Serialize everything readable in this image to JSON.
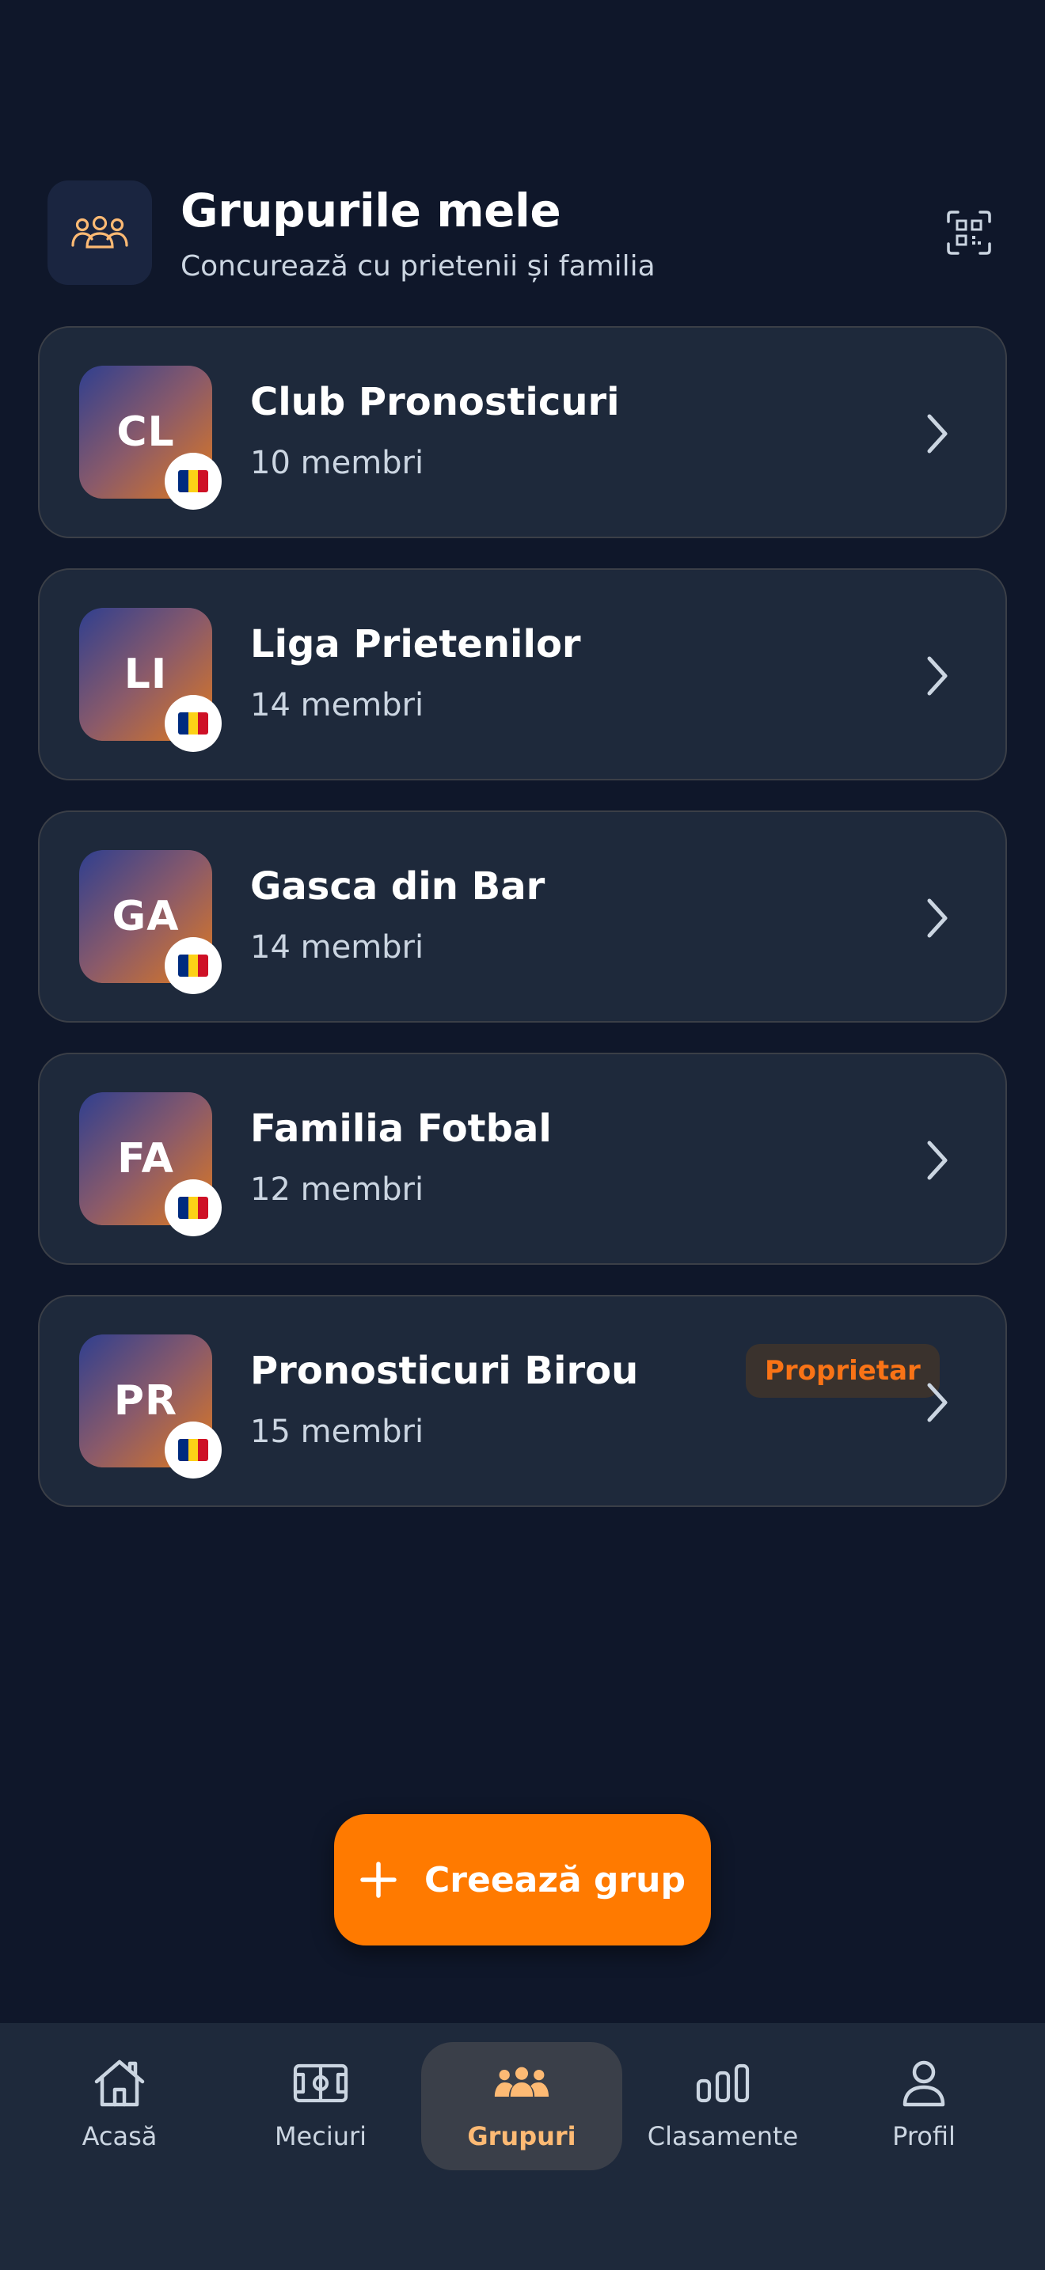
{
  "header": {
    "title": "Grupurile mele",
    "subtitle": "Concurează cu prietenii și familia",
    "icon": "groups-icon",
    "action_icon": "qr-scan-icon"
  },
  "groups": [
    {
      "initials": "CL",
      "name": "Club Pronosticuri",
      "members": "10 membri",
      "flag": "romania-flag-icon",
      "badge": ""
    },
    {
      "initials": "LI",
      "name": "Liga Prietenilor",
      "members": "14 membri",
      "flag": "romania-flag-icon",
      "badge": ""
    },
    {
      "initials": "GA",
      "name": "Gasca din Bar",
      "members": "14 membri",
      "flag": "romania-flag-icon",
      "badge": ""
    },
    {
      "initials": "FA",
      "name": "Familia Fotbal",
      "members": "12 membri",
      "flag": "romania-flag-icon",
      "badge": ""
    },
    {
      "initials": "PR",
      "name": "Pronosticuri Birou",
      "members": "15 membri",
      "flag": "romania-flag-icon",
      "badge": "Proprietar"
    }
  ],
  "create_button": {
    "label": "Creează grup",
    "icon": "plus-icon"
  },
  "nav": {
    "items": [
      {
        "label": "Acasă",
        "icon": "home-icon"
      },
      {
        "label": "Meciuri",
        "icon": "pitch-icon"
      },
      {
        "label": "Grupuri",
        "icon": "groups-icon"
      },
      {
        "label": "Clasamente",
        "icon": "bar-chart-icon"
      },
      {
        "label": "Profil",
        "icon": "user-icon"
      }
    ],
    "active": "Grupuri"
  },
  "colors": {
    "background": "#0f172a",
    "card": "#1e293b",
    "accent": "#ff7a00",
    "accent_light": "#fdba74",
    "flag_blue": "#002b7f",
    "flag_yellow": "#fcd116",
    "flag_red": "#ce1126"
  }
}
